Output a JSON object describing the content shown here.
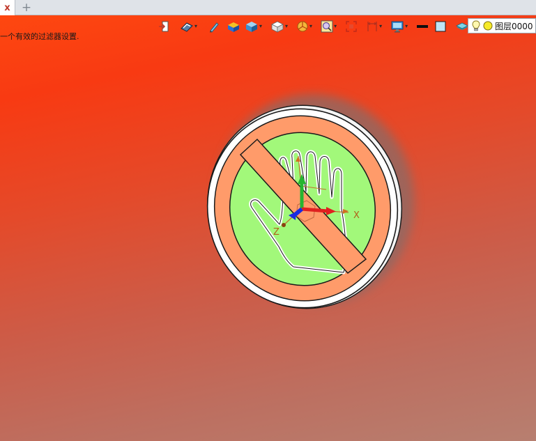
{
  "tabs": {
    "close_glyph": "x",
    "add_glyph": "+"
  },
  "status": {
    "message": "一个有效的过滤器设置."
  },
  "toolbar": {
    "items": [
      {
        "name": "exit-sketch-icon"
      },
      {
        "name": "display-mode-icon",
        "dropdown": true
      },
      {
        "name": "pencil-icon"
      },
      {
        "name": "solid-color-icon"
      },
      {
        "name": "shaded-cube-icon",
        "dropdown": true
      },
      {
        "name": "wire-cube-icon",
        "dropdown": true
      },
      {
        "name": "pie-filter-icon",
        "dropdown": true
      },
      {
        "name": "zoom-view-icon",
        "dropdown": true
      },
      {
        "name": "snap-target-icon"
      },
      {
        "name": "dimension-icon",
        "dropdown": true
      },
      {
        "name": "monitor-icon",
        "dropdown": true
      },
      {
        "name": "line-color-icon"
      },
      {
        "name": "fill-color-icon"
      },
      {
        "name": "layer-stack-icon",
        "dropdown": true
      }
    ],
    "caret_glyph": "▾"
  },
  "layer": {
    "label": "图层0000"
  },
  "viewport": {
    "axes": {
      "x_label": "X",
      "z_label": "Z"
    },
    "colors": {
      "ring": "#ff9b6a",
      "inner": "#a2f87a",
      "bg_top": "#ff4a10",
      "bg_bottom": "#b77f70"
    }
  }
}
